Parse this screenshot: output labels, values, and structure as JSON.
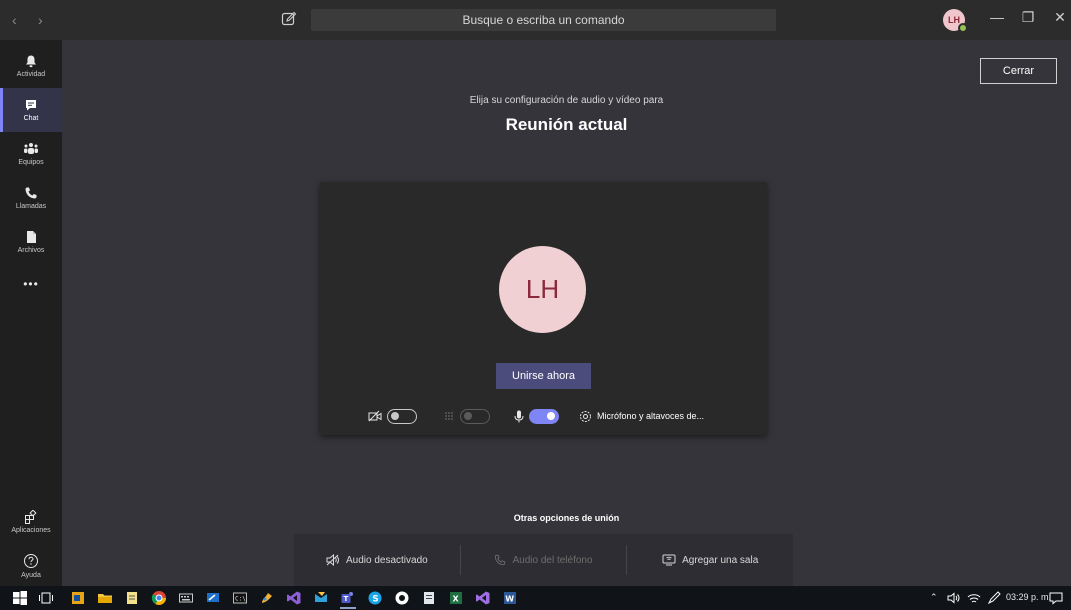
{
  "titlebar": {
    "search_placeholder": "Busque o escriba un comando",
    "user_initials": "LH",
    "nav_back": "‹",
    "nav_forward": "›",
    "minimize": "—",
    "maximize": "❐",
    "close": "✕"
  },
  "rail": {
    "items": [
      {
        "label": "Actividad",
        "icon": "bell-icon"
      },
      {
        "label": "Chat",
        "icon": "chat-icon",
        "active": true
      },
      {
        "label": "Equipos",
        "icon": "teams-icon"
      },
      {
        "label": "Llamadas",
        "icon": "phone-icon"
      },
      {
        "label": "Archivos",
        "icon": "file-icon"
      },
      {
        "label": "•••",
        "icon": "more-icon"
      }
    ],
    "bottom": [
      {
        "label": "Aplicaciones",
        "icon": "apps-icon"
      },
      {
        "label": "Ayuda",
        "icon": "help-icon"
      }
    ]
  },
  "main": {
    "close_label": "Cerrar",
    "subtitle": "Elija su configuración de audio y vídeo para",
    "title": "Reunión actual",
    "preview": {
      "initials": "LH",
      "join_label": "Unirse ahora",
      "video_toggle": false,
      "blur_toggle": false,
      "mic_toggle": true,
      "device_label": "Micrófono y altavoces de..."
    },
    "other_options_title": "Otras opciones de unión",
    "options": [
      {
        "label": "Audio desactivado",
        "icon": "speaker-off-icon",
        "enabled": true
      },
      {
        "label": "Audio del teléfono",
        "icon": "phone-icon",
        "enabled": false
      },
      {
        "label": "Agregar una sala",
        "icon": "room-icon",
        "enabled": true
      }
    ]
  },
  "taskbar": {
    "time": "03:29 p. m.",
    "colors": {
      "accent": "#7f85f5",
      "join": "#4b4c7c",
      "avatar_bg": "#f0d0d3",
      "avatar_fg": "#8a2a3c"
    }
  }
}
